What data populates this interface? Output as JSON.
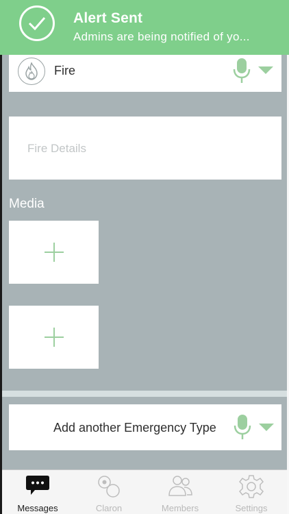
{
  "alert": {
    "title": "Alert Sent",
    "subtitle": "Admins are being notified of yo...",
    "color": "#7fcf8b",
    "icon": "check-circle-icon"
  },
  "emergency_type": {
    "selected": "Fire",
    "icon": "fire-icon"
  },
  "details": {
    "placeholder": "Fire Details"
  },
  "media": {
    "label": "Media",
    "tiles": [
      "add-media",
      "add-media"
    ]
  },
  "add_type": {
    "label": "Add another Emergency Type"
  },
  "tabs": [
    {
      "label": "Messages",
      "icon": "chat-bubble-icon",
      "active": true
    },
    {
      "label": "Claron",
      "icon": "claron-icon",
      "active": false
    },
    {
      "label": "Members",
      "icon": "members-icon",
      "active": false
    },
    {
      "label": "Settings",
      "icon": "gear-icon",
      "active": false
    }
  ],
  "colors": {
    "accent_green": "#9ccf9f",
    "background": "#a8b3b6"
  }
}
